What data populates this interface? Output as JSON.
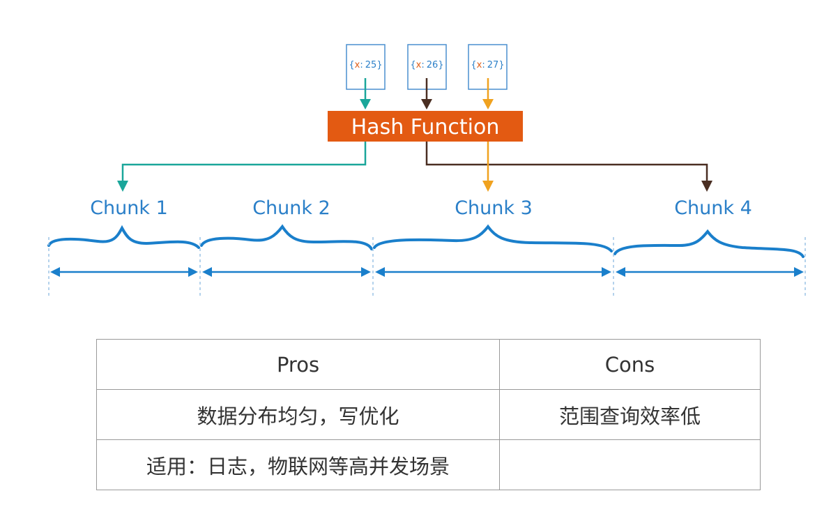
{
  "keys": [
    {
      "open": "{",
      "var": "x",
      "sep": ":",
      "val": "25",
      "close": "}",
      "color": "#1aa69a"
    },
    {
      "open": "{",
      "var": "x",
      "sep": ":",
      "val": "26",
      "close": "}",
      "color": "#4a2e22"
    },
    {
      "open": "{",
      "var": "x",
      "sep": ":",
      "val": "27",
      "close": "}",
      "color": "#f0a21f"
    }
  ],
  "hash_function": {
    "label": "Hash Function",
    "fill": "#e35a12"
  },
  "chunks": [
    "Chunk 1",
    "Chunk 2",
    "Chunk 3",
    "Chunk 4"
  ],
  "colors": {
    "blue": "#1a7fcb",
    "key_var": "#e0601a",
    "box_border": "#4a8fcf",
    "text_blue": "#2a7fc8"
  },
  "table": {
    "header_pros": "Pros",
    "header_cons": "Cons",
    "row1_pros": "数据分布均匀，写优化",
    "row1_cons": "范围查询效率低",
    "row2_pros": "适用：日志，物联网等高并发场景",
    "row2_cons": ""
  }
}
